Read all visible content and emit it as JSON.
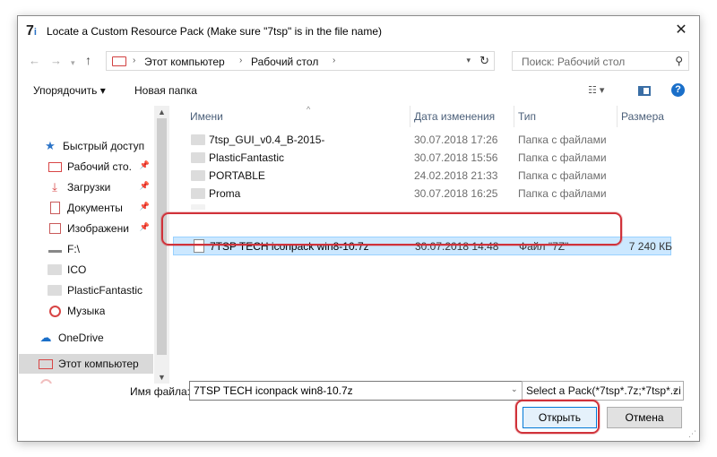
{
  "window": {
    "title": "Locate a Custom Resource Pack (Make sure \"7tsp\" is in the file name)",
    "app_icon_text": "7",
    "app_icon_sub": "i"
  },
  "address": {
    "path": [
      "Этот компьютер",
      "Рабочий стол"
    ],
    "search_placeholder": "Поиск: Рабочий стол"
  },
  "toolbar": {
    "organize_label": "Упорядочить ▾",
    "new_folder_label": "Новая папка"
  },
  "nav": {
    "items": [
      {
        "label": "Быстрый доступ",
        "icon": "star-icon",
        "pinned": false
      },
      {
        "label": "Рабочий сто.",
        "icon": "desktop-icon",
        "pinned": true
      },
      {
        "label": "Загрузки",
        "icon": "download-icon",
        "pinned": true
      },
      {
        "label": "Документы",
        "icon": "documents-icon",
        "pinned": true
      },
      {
        "label": "Изображени",
        "icon": "pictures-icon",
        "pinned": true
      },
      {
        "label": "F:\\",
        "icon": "drive-icon",
        "pinned": false
      },
      {
        "label": "ICO",
        "icon": "folder-icon",
        "pinned": false
      },
      {
        "label": "PlasticFantastic",
        "icon": "folder-icon",
        "pinned": false
      },
      {
        "label": "Музыка",
        "icon": "music-icon",
        "pinned": false
      },
      {
        "label": "OneDrive",
        "icon": "onedrive-icon",
        "pinned": false
      },
      {
        "label": "Этот компьютер",
        "icon": "computer-icon",
        "pinned": false,
        "selected": true
      }
    ]
  },
  "columns": {
    "name": "Имени",
    "date": "Дата изменения",
    "type": "Тип",
    "size": "Размера"
  },
  "files": [
    {
      "name": "7tsp_GUI_v0.4_B-2015-",
      "date": "30.07.2018 17:26",
      "type": "Папка с файлами",
      "size": ""
    },
    {
      "name": "PlasticFantastic",
      "date": "30.07.2018 15:56",
      "type": "Папка с файлами",
      "size": ""
    },
    {
      "name": "PORTABLE",
      "date": "24.02.2018 21:33",
      "type": "Папка с файлами",
      "size": ""
    },
    {
      "name": "Proma",
      "date": "30.07.2018 16:25",
      "type": "Папка с файлами",
      "size": ""
    },
    {
      "name": "7TSP TECH iconpack win8-10.7z",
      "date": "30.07.2018 14:48",
      "type": "Файл \"7Z\"",
      "size": "7 240 КБ"
    }
  ],
  "bottom": {
    "filename_label": "Имя файла:",
    "filename_value": "7TSP TECH iconpack win8-10.7z",
    "filter_value": "Select a Pack(*7tsp*.7z;*7tsp*.zi",
    "open_label": "Открыть",
    "cancel_label": "Отмена"
  }
}
